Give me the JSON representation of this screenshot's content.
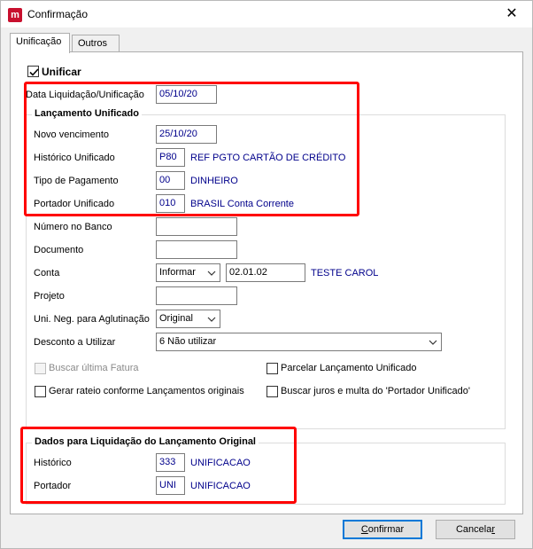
{
  "window": {
    "title": "Confirmação",
    "close_glyph": "✕"
  },
  "tabs": [
    {
      "label": "Unificação",
      "active": true
    },
    {
      "label": "Outros",
      "active": false
    }
  ],
  "unificar": {
    "label": "Unificar",
    "checked": true
  },
  "data_liquidacao": {
    "label": "Data Liquidação/Unificação",
    "value": "05/10/20"
  },
  "lancamento_unificado": {
    "title": "Lançamento Unificado",
    "novo_vencimento": {
      "label": "Novo vencimento",
      "value": "25/10/20"
    },
    "historico": {
      "label": "Histórico Unificado",
      "code": "P80",
      "desc": "REF PGTO CARTÃO DE CRÉDITO"
    },
    "tipo_pagamento": {
      "label": "Tipo de Pagamento",
      "code": "00",
      "desc": "DINHEIRO"
    },
    "portador": {
      "label": "Portador Unificado",
      "code": "010",
      "desc": "BRASIL Conta Corrente"
    },
    "numero_banco": {
      "label": "Número no Banco",
      "value": ""
    },
    "documento": {
      "label": "Documento",
      "value": ""
    },
    "conta": {
      "label": "Conta",
      "mode": "Informar",
      "code": "02.01.02",
      "desc": "TESTE CAROL"
    },
    "projeto": {
      "label": "Projeto",
      "value": ""
    },
    "uni_neg": {
      "label": "Uni. Neg. para Aglutinação",
      "value": "Original"
    },
    "desconto": {
      "label": "Desconto a Utilizar",
      "value": "6 Não utilizar"
    },
    "buscar_ultima_fatura": {
      "label": "Buscar última Fatura",
      "checked": false,
      "disabled": true
    },
    "parcelar": {
      "label": "Parcelar Lançamento Unificado",
      "checked": false
    },
    "gerar_rateio": {
      "label": "Gerar rateio conforme Lançamentos originais",
      "checked": false
    },
    "buscar_juros": {
      "label": "Buscar juros e multa do 'Portador Unificado'",
      "checked": false
    }
  },
  "dados_liquidacao": {
    "title": "Dados para Liquidação do Lançamento Original",
    "historico": {
      "label": "Histórico",
      "code": "333",
      "desc": "UNIFICACAO"
    },
    "portador": {
      "label": "Portador",
      "code": "UNI",
      "desc": "UNIFICACAO"
    }
  },
  "buttons": {
    "confirmar": {
      "label_first": "C",
      "label_rest": "onfirmar"
    },
    "cancelar": {
      "label_first": "Cancela",
      "label_u": "r"
    }
  },
  "colors": {
    "highlight": "#ff0000",
    "value_blue": "#00008b",
    "accent": "#0078d7"
  },
  "icons": {
    "app": "app-logo-icon",
    "close": "close-icon",
    "dropdown": "chevron-down-icon",
    "check": "check-icon"
  }
}
